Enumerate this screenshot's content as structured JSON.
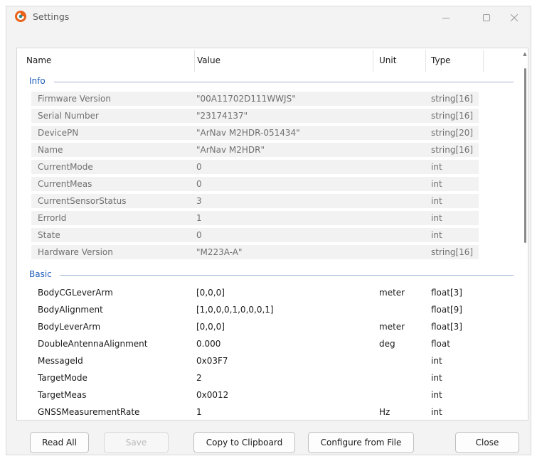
{
  "window": {
    "title": "Settings"
  },
  "table": {
    "columns": {
      "name": "Name",
      "value": "Value",
      "unit": "Unit",
      "type": "Type"
    },
    "groups": [
      {
        "label": "Info",
        "rows": [
          {
            "name": "Firmware Version",
            "value": "\"00A11702D111WWJS\"",
            "unit": "",
            "type": "string[16]"
          },
          {
            "name": "Serial Number",
            "value": "\"23174137\"",
            "unit": "",
            "type": "string[16]"
          },
          {
            "name": "DevicePN",
            "value": "\"ArNav M2HDR-051434\"",
            "unit": "",
            "type": "string[20]"
          },
          {
            "name": "Name",
            "value": "\"ArNav M2HDR\"",
            "unit": "",
            "type": "string[16]"
          },
          {
            "name": "CurrentMode",
            "value": "0",
            "unit": "",
            "type": "int"
          },
          {
            "name": "CurrentMeas",
            "value": "0",
            "unit": "",
            "type": "int"
          },
          {
            "name": "CurrentSensorStatus",
            "value": "3",
            "unit": "",
            "type": "int"
          },
          {
            "name": "ErrorId",
            "value": "1",
            "unit": "",
            "type": "int"
          },
          {
            "name": "State",
            "value": "0",
            "unit": "",
            "type": "int"
          },
          {
            "name": "Hardware Version",
            "value": "\"M223A-A\"",
            "unit": "",
            "type": "string[16]"
          }
        ]
      },
      {
        "label": "Basic",
        "rows": [
          {
            "name": "BodyCGLeverArm",
            "value": "[0,0,0]",
            "unit": "meter",
            "type": "float[3]"
          },
          {
            "name": "BodyAlignment",
            "value": "[1,0,0,0,1,0,0,0,1]",
            "unit": "",
            "type": "float[9]"
          },
          {
            "name": "BodyLeverArm",
            "value": "[0,0,0]",
            "unit": "meter",
            "type": "float[3]"
          },
          {
            "name": "DoubleAntennaAlignment",
            "value": "0.000",
            "unit": "deg",
            "type": "float"
          },
          {
            "name": "MessageId",
            "value": "0x03F7",
            "unit": "",
            "type": "int"
          },
          {
            "name": "TargetMode",
            "value": "2",
            "unit": "",
            "type": "int"
          },
          {
            "name": "TargetMeas",
            "value": "0x0012",
            "unit": "",
            "type": "int"
          },
          {
            "name": "GNSSMeasurementRate",
            "value": "1",
            "unit": "Hz",
            "type": "int"
          }
        ]
      }
    ]
  },
  "buttons": {
    "read_all": "Read All",
    "save": "Save",
    "copy": "Copy to Clipboard",
    "configure": "Configure from File",
    "close": "Close"
  },
  "colors": {
    "accent": "#1f5fb8",
    "app_icon_orange": "#e8631a",
    "app_icon_teal": "#2a8c8c"
  },
  "icons": {
    "app": "app-logo-icon",
    "minimize": "minimize-icon",
    "maximize": "maximize-icon",
    "close": "close-icon"
  }
}
